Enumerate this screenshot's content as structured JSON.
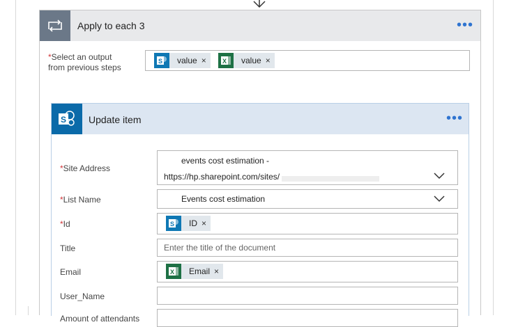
{
  "apply_each": {
    "title": "Apply to each 3",
    "more": "•••",
    "select_label_line1": "Select an output",
    "select_label_line2": "from previous steps",
    "tokens": [
      {
        "label": "value",
        "source": "sharepoint-icon"
      },
      {
        "label": "value",
        "source": "excel-icon"
      }
    ]
  },
  "update_item": {
    "title": "Update item",
    "more": "•••",
    "fields": {
      "site_address": {
        "label": "Site Address",
        "line1": "events cost estimation -",
        "line2": "https://hp.sharepoint.com/sites/"
      },
      "list_name": {
        "label": "List Name",
        "value": "Events cost estimation"
      },
      "id": {
        "label": "Id",
        "token": "ID"
      },
      "title": {
        "label": "Title",
        "placeholder": "Enter the title of the document"
      },
      "email": {
        "label": "Email",
        "token": "Email"
      },
      "user_name": {
        "label": "User_Name",
        "value": ""
      },
      "amount": {
        "label": "Amount of attendants",
        "value": ""
      }
    }
  },
  "required_mark": "*",
  "remove_mark": "×",
  "colors": {
    "loop_header": "#e8e9eb",
    "loop_icon": "#6b7888",
    "action_header": "#dce6f2",
    "sharepoint": "#0f78b4",
    "excel": "#1e7145",
    "accent": "#2f74d0",
    "required": "#d13438"
  }
}
